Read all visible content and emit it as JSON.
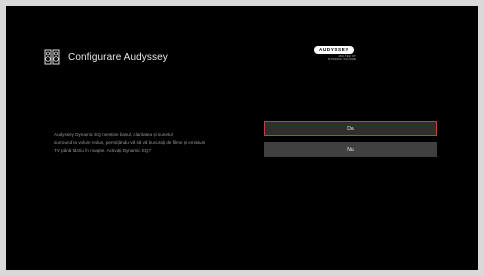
{
  "header": {
    "icon": "speaker-pair-icon",
    "title": "Configurare Audyssey"
  },
  "logo": {
    "brand": "AUDYSSEY",
    "line1": "MULTEQ XT",
    "line2": "DYNAMIC VOLUME"
  },
  "question": {
    "line1": "Audyssey Dynamic EQ menține basul, claritatea și sunetul",
    "line2": "surround la volum redus, permițându-vă să vă bucurați de filme și emisiuni",
    "line3": "TV până târziu în noapte. Activați Dynamic EQ?"
  },
  "options": [
    {
      "label": "Da",
      "selected": true
    },
    {
      "label": "Nu",
      "selected": false
    }
  ],
  "colors": {
    "background": "#000000",
    "selected_border": "#c0403a",
    "button_fill": "#404040"
  }
}
